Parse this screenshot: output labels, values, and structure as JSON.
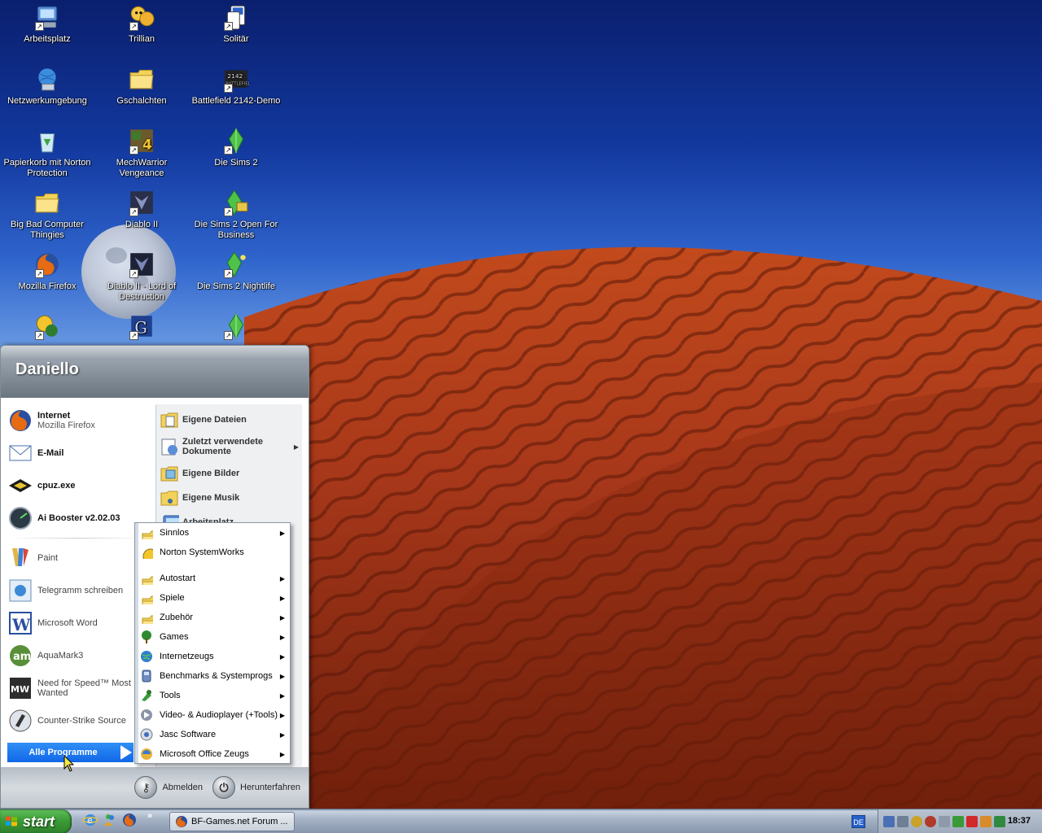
{
  "desktop": {
    "icons": [
      {
        "label": "Arbeitsplatz",
        "icon": "my-computer-icon",
        "shortcut": true
      },
      {
        "label": "Trillian",
        "icon": "trillian-icon",
        "shortcut": true
      },
      {
        "label": "Solitär",
        "icon": "solitaire-icon",
        "shortcut": true
      },
      {
        "label": "Netzwerkumgebung",
        "icon": "network-icon",
        "shortcut": false
      },
      {
        "label": "Gschalchten",
        "icon": "folder-icon",
        "shortcut": false
      },
      {
        "label": "Battlefield 2142-Demo",
        "icon": "battlefield-icon",
        "shortcut": true
      },
      {
        "label": "Papierkorb mit Norton Protection",
        "icon": "recycle-bin-icon",
        "shortcut": false
      },
      {
        "label": "MechWarrior Vengeance",
        "icon": "mechwarrior-icon",
        "shortcut": true
      },
      {
        "label": "Die Sims 2",
        "icon": "sims-icon",
        "shortcut": true
      },
      {
        "label": "Big Bad Computer Thingies",
        "icon": "folder-icon",
        "shortcut": false
      },
      {
        "label": "Diablo II",
        "icon": "diablo-icon",
        "shortcut": true
      },
      {
        "label": "Die Sims 2 Open For Business",
        "icon": "sims-business-icon",
        "shortcut": true
      },
      {
        "label": "Mozilla Firefox",
        "icon": "firefox-icon",
        "shortcut": true
      },
      {
        "label": "Diablo II - Lord of Destruction",
        "icon": "diablo-lod-icon",
        "shortcut": true
      },
      {
        "label": "Die Sims 2 Nightlife",
        "icon": "sims-nightlife-icon",
        "shortcut": true
      },
      {
        "label": "",
        "icon": "norton-icon",
        "shortcut": true
      },
      {
        "label": "",
        "icon": "gothic-icon",
        "shortcut": true
      },
      {
        "label": "",
        "icon": "sims-icon",
        "shortcut": true
      }
    ]
  },
  "start_menu": {
    "user_name": "Daniello",
    "pinned": [
      {
        "title": "Internet",
        "subtitle": "Mozilla Firefox",
        "icon": "firefox-icon"
      },
      {
        "title": "E-Mail",
        "subtitle": "",
        "icon": "email-icon"
      },
      {
        "title": "cpuz.exe",
        "subtitle": "",
        "icon": "chip-icon"
      },
      {
        "title": "Ai Booster v2.02.03",
        "subtitle": "",
        "icon": "gauge-icon"
      }
    ],
    "recent": [
      {
        "label": "Paint",
        "icon": "paint-icon"
      },
      {
        "label": "Telegramm schreiben",
        "icon": "telegram-icon"
      },
      {
        "label": "Microsoft Word",
        "icon": "word-icon"
      },
      {
        "label": "AquaMark3",
        "icon": "aquamark-icon"
      },
      {
        "label": "Need for Speed™ Most Wanted",
        "icon": "nfs-icon"
      },
      {
        "label": "Counter-Strike Source",
        "icon": "counter-strike-icon"
      }
    ],
    "all_programs_label": "Alle Programme",
    "places": [
      {
        "label": "Eigene Dateien",
        "icon": "documents-folder-icon",
        "submenu": false
      },
      {
        "label": "Zuletzt verwendete Dokumente",
        "icon": "recent-docs-icon",
        "submenu": true
      },
      {
        "label": "Eigene Bilder",
        "icon": "pictures-folder-icon",
        "submenu": false
      },
      {
        "label": "Eigene Musik",
        "icon": "music-folder-icon",
        "submenu": false
      },
      {
        "label": "Arbeitsplatz",
        "icon": "my-computer-icon",
        "submenu": false
      }
    ],
    "logoff_label": "Abmelden",
    "shutdown_label": "Herunterfahren"
  },
  "programs_menu": {
    "groups": [
      [
        {
          "label": "Sinnlos",
          "icon": "folder-icon",
          "submenu": true
        },
        {
          "label": "Norton SystemWorks",
          "icon": "norton-icon",
          "submenu": false
        }
      ],
      [
        {
          "label": "Autostart",
          "icon": "folder-icon",
          "submenu": true
        },
        {
          "label": "Spiele",
          "icon": "folder-icon",
          "submenu": true
        },
        {
          "label": "Zubehör",
          "icon": "folder-icon",
          "submenu": true
        },
        {
          "label": "Games",
          "icon": "tree-icon",
          "submenu": true
        },
        {
          "label": "Internetzeugs",
          "icon": "globe-icon",
          "submenu": true
        },
        {
          "label": "Benchmarks & Systemprogs",
          "icon": "benchmark-icon",
          "submenu": true
        },
        {
          "label": "Tools",
          "icon": "tools-icon",
          "submenu": true
        },
        {
          "label": "Video- & Audioplayer (+Tools)",
          "icon": "media-icon",
          "submenu": true
        },
        {
          "label": "Jasc Software",
          "icon": "jasc-icon",
          "submenu": true
        },
        {
          "label": "Microsoft Office Zeugs",
          "icon": "office-icon",
          "submenu": true
        }
      ]
    ]
  },
  "taskbar": {
    "start_label": "start",
    "quick_launch": [
      "ie-icon",
      "messenger-icon",
      "firefox-icon"
    ],
    "more_label": "»",
    "window_button_label": "BF-Games.net Forum ...",
    "language": "DE",
    "clock": "18:37"
  }
}
